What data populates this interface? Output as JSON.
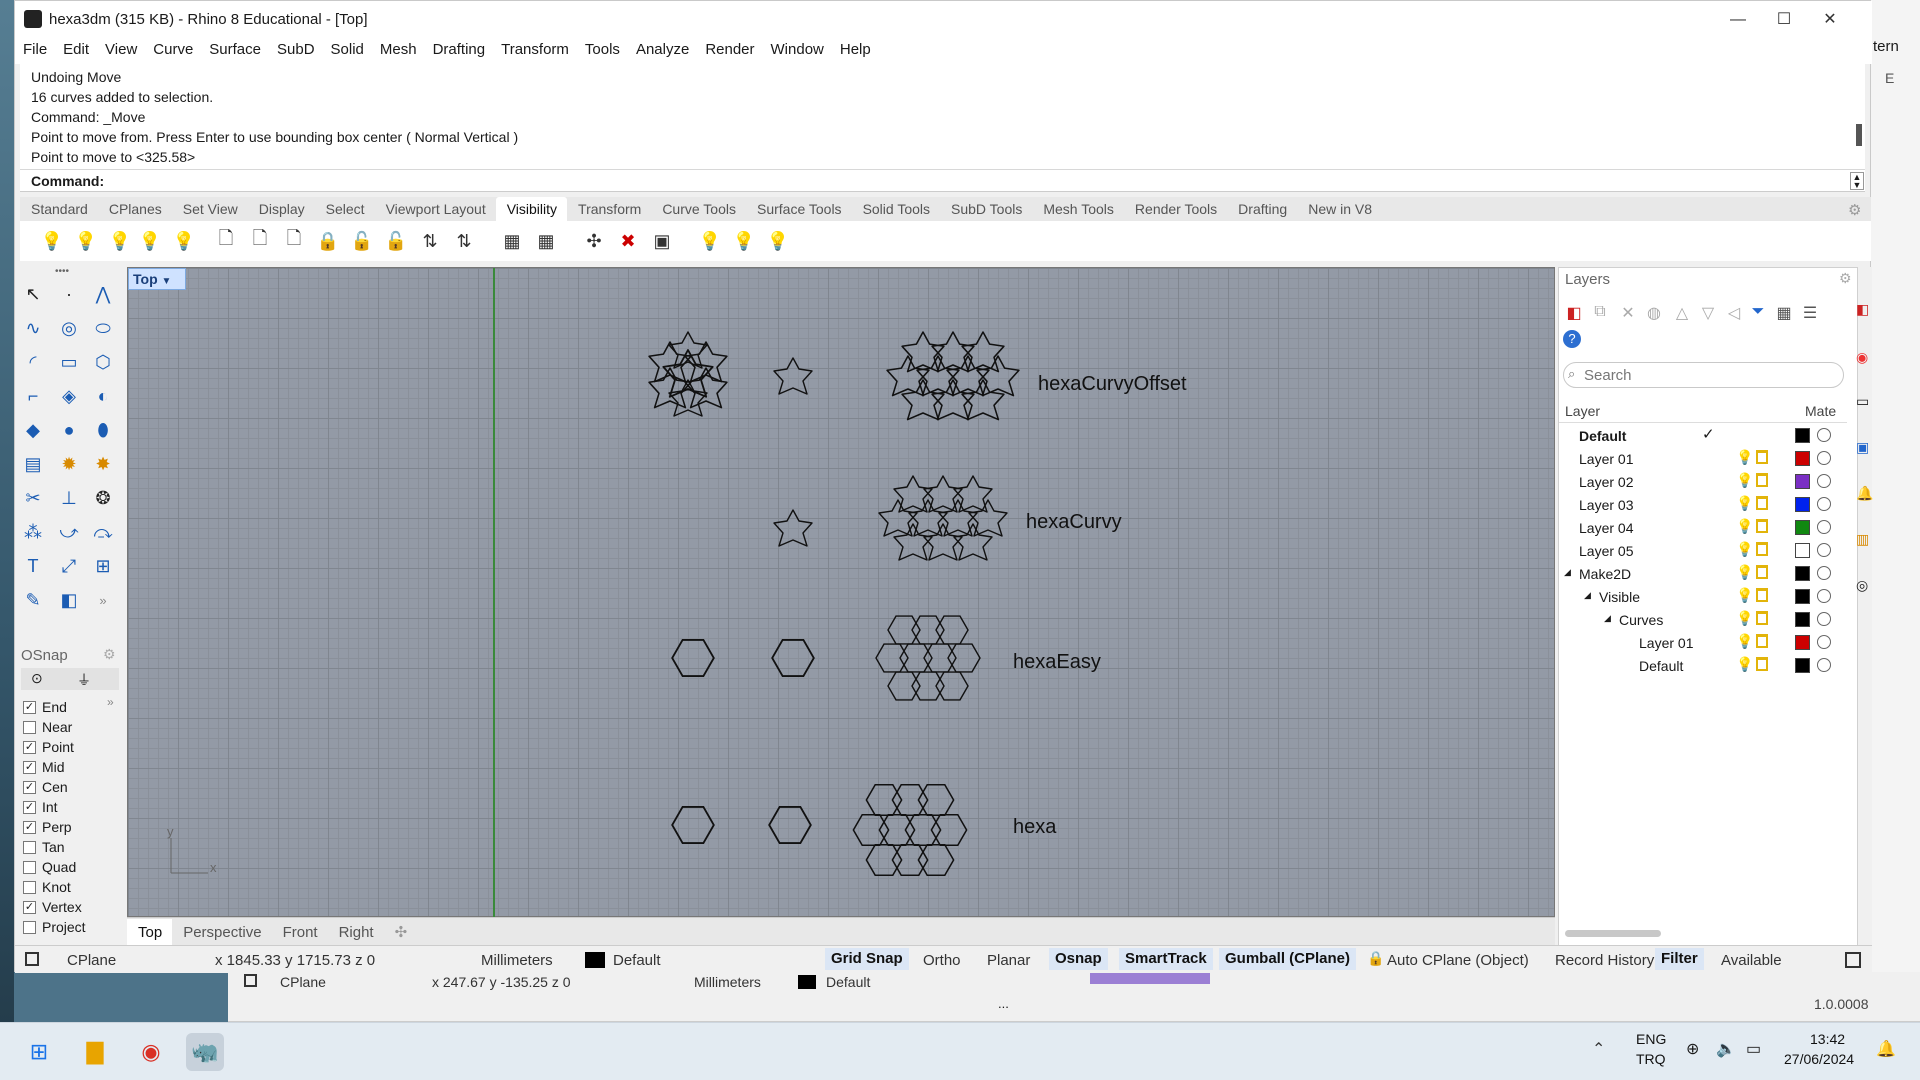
{
  "window": {
    "title": "hexa3dm (315 KB) - Rhino 8 Educational - [Top]",
    "close_glyph": "✕",
    "min_glyph": "—",
    "max_glyph": "☐"
  },
  "menu": [
    "File",
    "Edit",
    "View",
    "Curve",
    "Surface",
    "SubD",
    "Solid",
    "Mesh",
    "Drafting",
    "Transform",
    "Tools",
    "Analyze",
    "Render",
    "Window",
    "Help"
  ],
  "command_history": [
    "Undoing Move",
    "16 curves added to selection.",
    "Command: _Move",
    "Point to move from. Press Enter to use bounding box center ( Normal  Vertical )",
    "Point to move to <325.58>"
  ],
  "command_prompt": "Command:",
  "toolbar_tabs": [
    "Standard",
    "CPlanes",
    "Set View",
    "Display",
    "Select",
    "Viewport Layout",
    "Visibility",
    "Transform",
    "Curve Tools",
    "Surface Tools",
    "Solid Tools",
    "SubD Tools",
    "Mesh Tools",
    "Render Tools",
    "Drafting",
    "New in V8"
  ],
  "active_toolbar_tab": "Visibility",
  "viewport": {
    "label": "Top",
    "labels": {
      "r1": "hexaCurvyOffset",
      "r2": "hexaCurvy",
      "r3": "hexaEasy",
      "r4": "hexa"
    },
    "axis_x": "x",
    "axis_y": "y"
  },
  "viewport_tabs": [
    "Top",
    "Perspective",
    "Front",
    "Right"
  ],
  "osnap": {
    "title": "OSnap",
    "items": [
      {
        "label": "End",
        "checked": true
      },
      {
        "label": "Near",
        "checked": false
      },
      {
        "label": "Point",
        "checked": true
      },
      {
        "label": "Mid",
        "checked": true
      },
      {
        "label": "Cen",
        "checked": true
      },
      {
        "label": "Int",
        "checked": true
      },
      {
        "label": "Perp",
        "checked": true
      },
      {
        "label": "Tan",
        "checked": false
      },
      {
        "label": "Quad",
        "checked": false
      },
      {
        "label": "Knot",
        "checked": false
      },
      {
        "label": "Vertex",
        "checked": true
      },
      {
        "label": "Project",
        "checked": false
      }
    ]
  },
  "layers_panel": {
    "title": "Layers",
    "search_placeholder": "Search",
    "col_layer": "Layer",
    "col_material": "Mate",
    "rows": [
      {
        "name": "Default",
        "color": "#000000",
        "bold": true,
        "current": true
      },
      {
        "name": "Layer 01",
        "color": "#cc0000"
      },
      {
        "name": "Layer 02",
        "color": "#7a2fc4"
      },
      {
        "name": "Layer 03",
        "color": "#0022ee"
      },
      {
        "name": "Layer 04",
        "color": "#118811"
      },
      {
        "name": "Layer 05",
        "color": "#ffffff"
      },
      {
        "name": "Make2D",
        "color": "#000000"
      },
      {
        "name": "Visible",
        "color": "#000000"
      },
      {
        "name": "Curves",
        "color": "#000000"
      },
      {
        "name": "Layer 01",
        "color": "#cc0000"
      },
      {
        "name": "Default",
        "color": "#000000"
      }
    ]
  },
  "statusbar": {
    "cplane": "CPlane",
    "coords": "x 1845.33  y 1715.73  z 0",
    "units": "Millimeters",
    "layer": "Default",
    "grid_snap": "Grid Snap",
    "ortho": "Ortho",
    "planar": "Planar",
    "osnap": "Osnap",
    "smarttrack": "SmartTrack",
    "gumball": "Gumball (CPlane)",
    "auto_cplane": "Auto CPlane (Object)",
    "record_history": "Record History",
    "filter": "Filter",
    "available": "Available"
  },
  "background_window": {
    "cplane": "CPlane",
    "coords": "x 247.67  y -135.25  z 0",
    "units": "Millimeters",
    "layer": "Default",
    "version": "1.0.0008",
    "ellipsis": "..."
  },
  "right_edge": {
    "text1": "tern",
    "text2": "E"
  },
  "taskbar": {
    "lang1": "ENG",
    "lang2": "TRQ",
    "time": "13:42",
    "date": "27/06/2024"
  }
}
